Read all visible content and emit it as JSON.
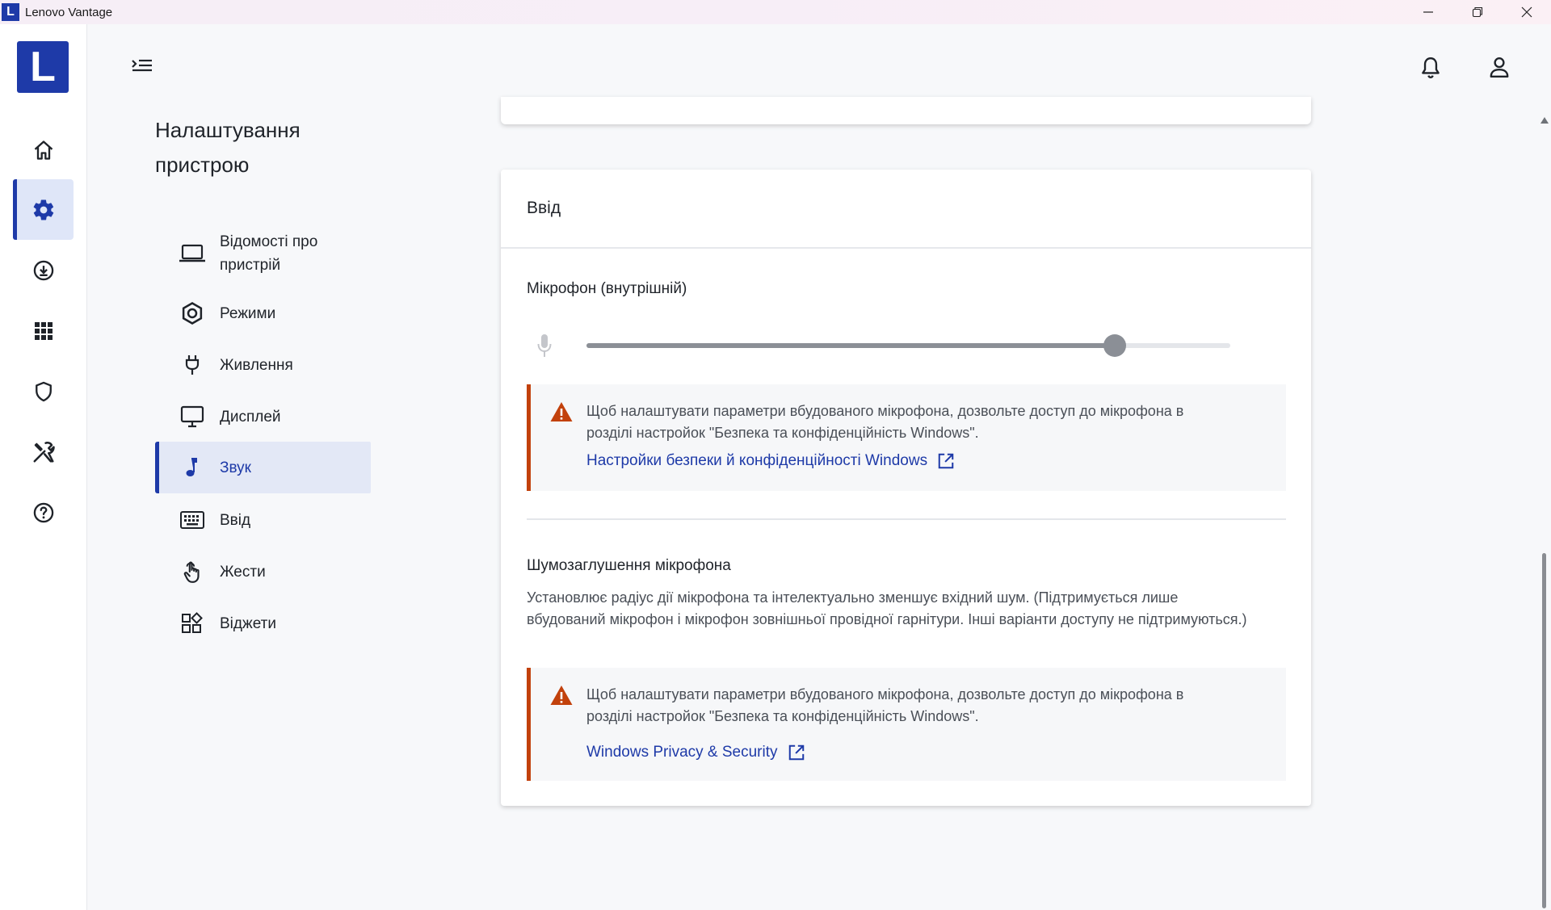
{
  "window": {
    "title": "Lenovo Vantage",
    "logo_letter": "L"
  },
  "rail": {
    "logo_letter": "L",
    "items": [
      {
        "name": "home"
      },
      {
        "name": "device-settings",
        "active": true
      },
      {
        "name": "system-update"
      },
      {
        "name": "apps"
      },
      {
        "name": "security"
      },
      {
        "name": "tools"
      },
      {
        "name": "help"
      }
    ]
  },
  "section": {
    "title": "Налаштування пристрою",
    "nav": [
      {
        "label": "Відомості про пристрій",
        "icon": "laptop-icon"
      },
      {
        "label": "Режими",
        "icon": "hexagon-icon"
      },
      {
        "label": "Живлення",
        "icon": "plug-icon"
      },
      {
        "label": "Дисплей",
        "icon": "monitor-icon"
      },
      {
        "label": "Звук",
        "icon": "music-note-icon",
        "active": true
      },
      {
        "label": "Ввід",
        "icon": "keyboard-icon"
      },
      {
        "label": "Жести",
        "icon": "touch-icon"
      },
      {
        "label": "Віджети",
        "icon": "widgets-icon"
      }
    ]
  },
  "input_card": {
    "title": "Ввід",
    "microphone": {
      "label": "Мікрофон (внутрішній)",
      "level": 0.82
    },
    "warning1": {
      "text": "Щоб налаштувати параметри вбудованого мікрофона, дозвольте доступ до мікрофона в розділі настройок \"Безпека та конфіденційність Windows\".",
      "link": "Настройки безпеки й конфіденційності Windows"
    },
    "noise": {
      "title": "Шумозаглушення мікрофона",
      "description": "Установлює радіус дії мікрофона та інтелектуально зменшує вхідний шум. (Підтримується лише вбудований мікрофон і мікрофон зовнішньої провідної гарнітури. Інші варіанти доступу не підтримуються.)"
    },
    "warning2": {
      "text": "Щоб налаштувати параметри вбудованого мікрофона, дозвольте доступ до мікрофона в розділі настройок \"Безпека та конфіденційність Windows\".",
      "link": "Windows Privacy & Security"
    }
  },
  "colors": {
    "accent": "#1e3aa8",
    "warning": "#c2410c"
  }
}
